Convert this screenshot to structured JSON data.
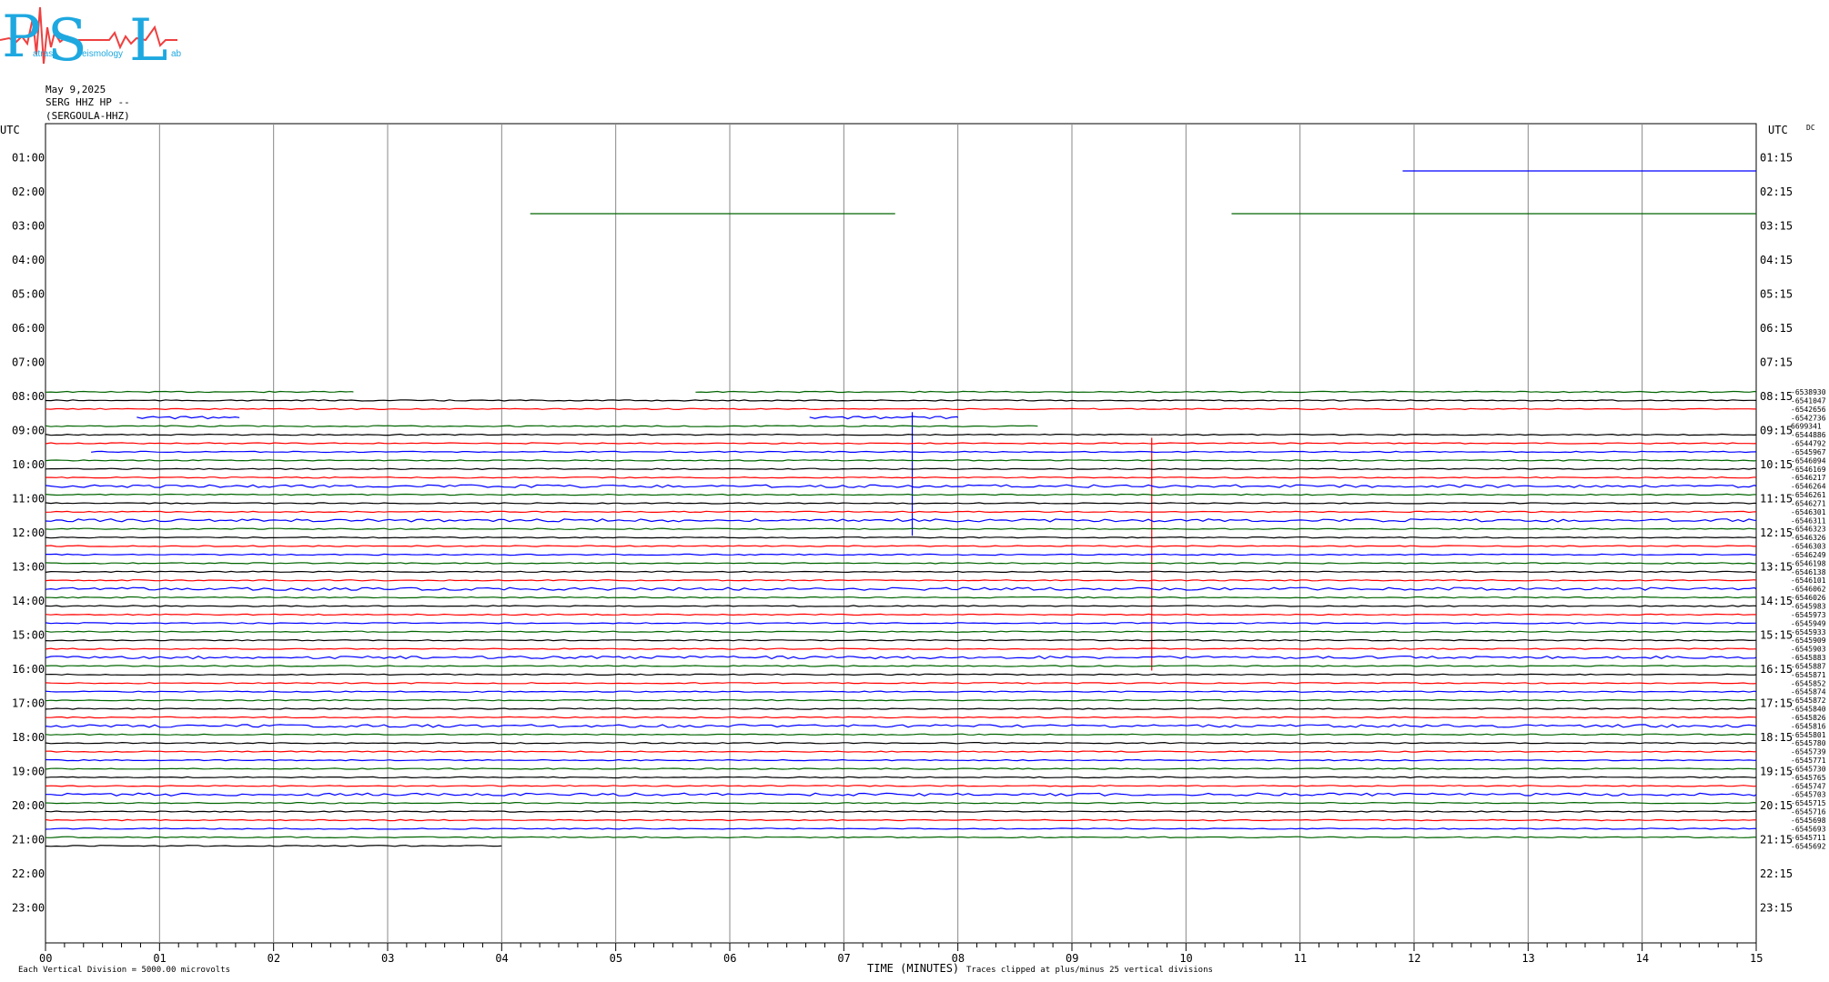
{
  "header": {
    "date": "May 9,2025",
    "station": "SERG HHZ HP --",
    "location": "(SERGOULA-HHZ)",
    "left_utc": "UTC",
    "right_utc": "UTC",
    "dc": "DC"
  },
  "logo": {
    "letters": [
      "P",
      "S",
      "L"
    ],
    "small_words": [
      "atras",
      "eismology",
      "ab"
    ],
    "colors": {
      "letters": "#1ea8e0",
      "trace": "#ef4040"
    }
  },
  "chart_data": {
    "type": "line",
    "title": "",
    "xlabel": "TIME (MINUTES)",
    "xlim": [
      0,
      15
    ],
    "x_ticks": [
      "00",
      "01",
      "02",
      "03",
      "04",
      "05",
      "06",
      "07",
      "08",
      "09",
      "10",
      "11",
      "12",
      "13",
      "14",
      "15"
    ],
    "left_labels": [
      "01:00",
      "02:00",
      "03:00",
      "04:00",
      "05:00",
      "06:00",
      "07:00",
      "08:00",
      "09:00",
      "10:00",
      "11:00",
      "12:00",
      "13:00",
      "14:00",
      "15:00",
      "16:00",
      "17:00",
      "18:00",
      "19:00",
      "20:00",
      "21:00",
      "22:00",
      "23:00"
    ],
    "right_labels": [
      "01:15",
      "02:15",
      "03:15",
      "04:15",
      "05:15",
      "06:15",
      "07:15",
      "08:15",
      "09:15",
      "10:15",
      "11:15",
      "12:15",
      "13:15",
      "14:15",
      "15:15",
      "16:15",
      "17:15",
      "18:15",
      "19:15",
      "20:15",
      "21:15",
      "22:15",
      "23:15"
    ],
    "trace_labels": [
      "-6538930",
      "-6541047",
      "-6542656",
      "-6542736",
      "6699341",
      "-6544886",
      "-6544792",
      "-6545967",
      "-6546094",
      "-6546169",
      "-6546217",
      "-6546264",
      "-6546261",
      "-6546271",
      "-6546301",
      "-6546311",
      "-6546323",
      "-6546326",
      "-6546303",
      "-6546249",
      "-6546198",
      "-6546138",
      "-6546101",
      "-6546062",
      "-6546026",
      "-6545983",
      "-6545973",
      "-6545949",
      "-6545933",
      "-6545909",
      "-6545903",
      "-6545883",
      "-6545887",
      "-6545871",
      "-6545852",
      "-6545874",
      "-6545872",
      "-6545840",
      "-6545826",
      "-6545816",
      "-6545801",
      "-6545780",
      "-6545739",
      "-6545771",
      "-6545730",
      "-6545765",
      "-6545747",
      "-6545703",
      "-6545715",
      "-6545716",
      "-6545698",
      "-6545693",
      "-6545711",
      "-6545692"
    ],
    "series_colors": [
      "#006400",
      "#000000",
      "#ff0000",
      "#0000ff"
    ],
    "notes": {
      "left": "Each Vertical Division = 5000.00 microvolts",
      "right": "Traces clipped at plus/minus 25 vertical divisions"
    },
    "grid": true
  }
}
